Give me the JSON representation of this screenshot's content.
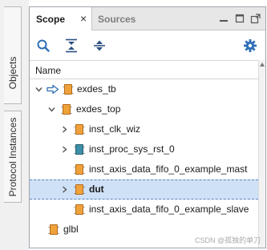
{
  "side_tabs": [
    {
      "label": "Objects"
    },
    {
      "label": "Protocol Instances"
    }
  ],
  "tabs": [
    {
      "label": "Scope",
      "active": true,
      "close_glyph": "×"
    },
    {
      "label": "Sources",
      "active": false
    }
  ],
  "toolbar": {
    "buttons": [
      "search-icon",
      "collapse-all-icon",
      "expand-all-icon",
      "gear-icon"
    ]
  },
  "tree": {
    "column_header": "Name",
    "rows": [
      {
        "label": "exdes_tb",
        "expanded": true,
        "icon": "orange-module-icon",
        "top_marker": true
      },
      {
        "label": "exdes_top",
        "expanded": true,
        "icon": "orange-module-icon"
      },
      {
        "label": "inst_clk_wiz",
        "expanded": false,
        "icon": "orange-module-icon"
      },
      {
        "label": "inst_proc_sys_rst_0",
        "expanded": false,
        "icon": "teal-module-icon"
      },
      {
        "label": "inst_axis_data_fifo_0_example_mast",
        "expanded": null,
        "icon": "orange-module-icon"
      },
      {
        "label": "dut",
        "expanded": false,
        "icon": "orange-module-icon",
        "selected": true
      },
      {
        "label": "inst_axis_data_fifo_0_example_slave",
        "expanded": null,
        "icon": "orange-module-icon"
      },
      {
        "label": "glbl",
        "expanded": null,
        "icon": "orange-module-icon"
      }
    ]
  },
  "watermark": "CSDN @孤独的单刀",
  "colors": {
    "selection": "#cfe1f7",
    "module_orange": "#f0a23a",
    "module_teal": "#3d8fa8",
    "accent_blue": "#2f6fb6"
  }
}
